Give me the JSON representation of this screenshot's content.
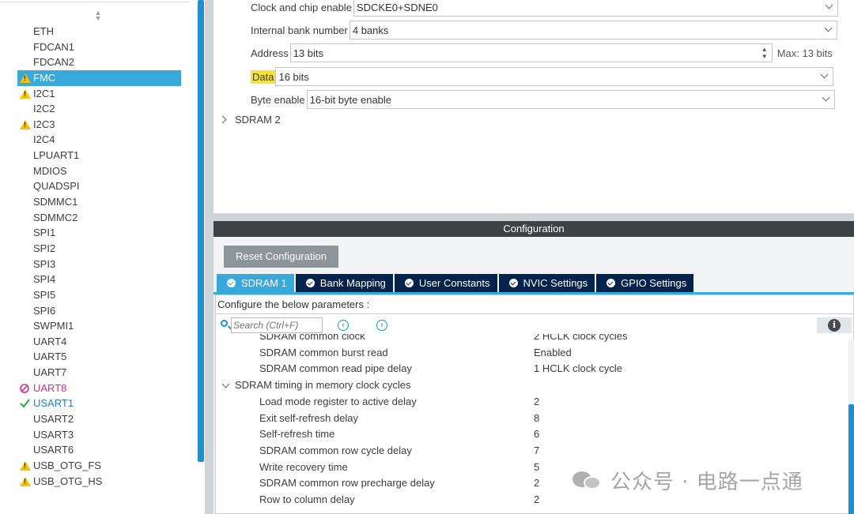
{
  "sidebar": {
    "items": [
      {
        "label": "ETH",
        "status": "none"
      },
      {
        "label": "FDCAN1",
        "status": "none"
      },
      {
        "label": "FDCAN2",
        "status": "none"
      },
      {
        "label": "FMC",
        "status": "warning",
        "selected": true
      },
      {
        "label": "I2C1",
        "status": "warning"
      },
      {
        "label": "I2C2",
        "status": "none"
      },
      {
        "label": "I2C3",
        "status": "warning"
      },
      {
        "label": "I2C4",
        "status": "none"
      },
      {
        "label": "LPUART1",
        "status": "none"
      },
      {
        "label": "MDIOS",
        "status": "none"
      },
      {
        "label": "QUADSPI",
        "status": "none"
      },
      {
        "label": "SDMMC1",
        "status": "none"
      },
      {
        "label": "SDMMC2",
        "status": "none"
      },
      {
        "label": "SPI1",
        "status": "none"
      },
      {
        "label": "SPI2",
        "status": "none"
      },
      {
        "label": "SPI3",
        "status": "none"
      },
      {
        "label": "SPI4",
        "status": "none"
      },
      {
        "label": "SPI5",
        "status": "none"
      },
      {
        "label": "SPI6",
        "status": "none"
      },
      {
        "label": "SWPMI1",
        "status": "none"
      },
      {
        "label": "UART4",
        "status": "none"
      },
      {
        "label": "UART5",
        "status": "none"
      },
      {
        "label": "UART7",
        "status": "none"
      },
      {
        "label": "UART8",
        "status": "error"
      },
      {
        "label": "USART1",
        "status": "ok"
      },
      {
        "label": "USART2",
        "status": "none"
      },
      {
        "label": "USART3",
        "status": "none"
      },
      {
        "label": "USART6",
        "status": "none"
      },
      {
        "label": "USB_OTG_FS",
        "status": "warning"
      },
      {
        "label": "USB_OTG_HS",
        "status": "warning"
      }
    ]
  },
  "fmc_params": {
    "clock_chip_enable": {
      "label": "Clock and chip enable",
      "value": "SDCKE0+SDNE0"
    },
    "internal_bank": {
      "label": "Internal bank number",
      "value": "4 banks"
    },
    "address": {
      "label": "Address",
      "value": "13 bits",
      "max": "Max: 13 bits"
    },
    "data": {
      "label": "Data",
      "value": "16 bits"
    },
    "byte_enable": {
      "label": "Byte enable",
      "value": "16-bit byte enable"
    },
    "sdram2_label": "SDRAM 2"
  },
  "configuration": {
    "title": "Configuration",
    "reset_label": "Reset Configuration",
    "tabs": [
      "SDRAM 1",
      "Bank Mapping",
      "User Constants",
      "NVIC Settings",
      "GPIO Settings"
    ],
    "hint": "Configure the below parameters :",
    "search_placeholder": "Search (Ctrl+F)",
    "prev_icon": "arrow-left-circle-icon",
    "next_icon": "arrow-right-circle-icon",
    "info_icon": "info-icon",
    "rows": [
      {
        "name": "SDRAM common clock",
        "value": "2 HCLK clock cycles",
        "group": false
      },
      {
        "name": "SDRAM common burst read",
        "value": "Enabled",
        "group": false
      },
      {
        "name": "SDRAM common read pipe delay",
        "value": "1 HCLK clock cycle",
        "group": false
      },
      {
        "name": "SDRAM timing in memory clock cycles",
        "value": "",
        "group": true
      },
      {
        "name": "Load mode register to active delay",
        "value": "2",
        "group": false
      },
      {
        "name": "Exit self-refresh delay",
        "value": "8",
        "group": false
      },
      {
        "name": "Self-refresh time",
        "value": "6",
        "group": false
      },
      {
        "name": "SDRAM common row cycle delay",
        "value": "7",
        "group": false
      },
      {
        "name": "Write recovery time",
        "value": "5",
        "group": false
      },
      {
        "name": "SDRAM common row precharge delay",
        "value": "2",
        "group": false
      },
      {
        "name": "Row to column delay",
        "value": "2",
        "group": false
      }
    ]
  },
  "watermark": {
    "text": "公众号 · 电路一点通"
  },
  "colors": {
    "accent": "#39a9dc",
    "tab_dark": "#03234b",
    "warning": "#f2c30a",
    "error": "#d62b82",
    "ok": "#1f7fc4",
    "highlight": "#f7e23a"
  }
}
